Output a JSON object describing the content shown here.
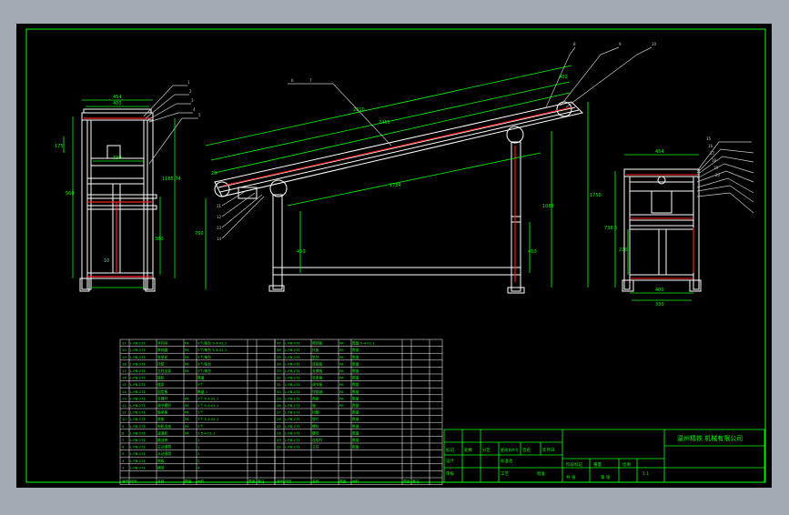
{
  "drawing": {
    "background_color": "#000000",
    "frame_color": "#00ff00",
    "line_color": "#ffffff",
    "accent_color": "#ff2020",
    "leader_color": "#c8c8c8",
    "company": "温州精铁 机械有限公司"
  },
  "dimensions": {
    "front_top": "454",
    "front_inner": "400",
    "front_mid": "330",
    "front_left_175": "175",
    "front_left_560": "560",
    "front_1165": "1165.74",
    "front_380": "380",
    "front_10": "10",
    "side_2610": "2610",
    "side_2455": "2455",
    "side_1784": "1784",
    "side_1750": "1750",
    "side_1088": "1088",
    "side_400": "400",
    "side_450": "450",
    "side_760": "760",
    "side_20": "20",
    "right_top": "454",
    "right_left": "738.5",
    "right_220": "220",
    "right_bottom": "400",
    "right_base": "330"
  },
  "bom": {
    "rows_left": [
      [
        "21",
        "L-PB-271",
        "导向块",
        "PA",
        "3个/每台 5-4-01.1"
      ],
      [
        "20",
        "L-PB-271",
        "联轴器",
        "PA",
        "3个/每台 5-4-01.1"
      ],
      [
        "19",
        "L-PB-271",
        "张紧轮",
        "PA",
        "3个/每台"
      ],
      [
        "18",
        "L-PB-271",
        "托辊",
        "PA",
        "3个/每台"
      ],
      [
        "17",
        "L-PB-271",
        "立柱支架",
        "PA",
        "3个/每台"
      ],
      [
        "16",
        "L-PB-271",
        "链轮",
        "",
        "数量"
      ],
      [
        "15",
        "L-PB-271",
        "链条",
        "",
        "3个"
      ],
      [
        "14",
        "L-PB-271",
        "固定板",
        "",
        "数量 1"
      ],
      [
        "13",
        "L-PB-271",
        "支撑杆",
        "PA",
        "3个 5-4-01.1"
      ],
      [
        "12",
        "L-PB-271",
        "调节螺杆",
        "PA",
        "3个 5-4-01.1"
      ],
      [
        "11",
        "L-PB-271",
        "轴承座",
        "PA",
        "3个"
      ],
      [
        "10",
        "L-PB-271",
        "底座",
        "PA",
        "3个 5-4-01.1"
      ],
      [
        "9",
        "L-PB-271",
        "电机支座",
        "PA",
        "3个"
      ],
      [
        "8",
        "L-PB-271",
        "减速机",
        "PA",
        "1 5-4-01.1"
      ],
      [
        "7",
        "L-PB-271",
        "输送带",
        "",
        "1"
      ],
      [
        "6",
        "L-PB-271",
        "主动滚筒",
        "",
        "1"
      ],
      [
        "5",
        "L-PB-271",
        "从动滚筒",
        "",
        "1"
      ],
      [
        "4",
        "L-PB-271",
        "侧板",
        "",
        "2"
      ],
      [
        "3",
        "L-PB-271",
        "横梁",
        "",
        "4"
      ]
    ],
    "rows_right": [
      [
        "37",
        "L-PB-271",
        "侧挡板",
        "PA",
        "数量 5-4-01.1"
      ],
      [
        "36",
        "L-PB-271",
        "托板",
        "PA",
        "数量"
      ],
      [
        "35",
        "L-PB-271",
        "垫块",
        "PA",
        "数量"
      ],
      [
        "34",
        "L-PB-271",
        "连接板",
        "PA",
        "数量"
      ],
      [
        "33",
        "L-PB-271",
        "支撑板",
        "PA",
        "数量"
      ],
      [
        "32",
        "L-PB-271",
        "张紧座",
        "PA",
        "数量"
      ],
      [
        "31",
        "L-PB-271",
        "调节板",
        "PA",
        "数量"
      ],
      [
        "30",
        "L-PB-271",
        "铰链轴",
        "PA",
        "数量"
      ],
      [
        "29",
        "L-PB-271",
        "角座",
        "PA",
        "数量"
      ],
      [
        "28",
        "L-PB-271",
        "轴",
        "PA",
        "数量"
      ],
      [
        "27",
        "L-PB-271",
        "挡圈",
        "",
        "数量"
      ],
      [
        "26",
        "L-PB-271",
        "垫片",
        "",
        "数量"
      ],
      [
        "25",
        "L-PB-271",
        "螺栓",
        "",
        "数量"
      ],
      [
        "24",
        "L-PB-271",
        "螺母",
        "",
        "数量"
      ],
      [
        "23",
        "L-PB-271",
        "连接杆",
        "",
        "数量"
      ],
      [
        "22",
        "L-PB-271",
        "立柱",
        "",
        "数量"
      ],
      [
        "",
        "",
        "",
        "",
        ""
      ],
      [
        "",
        "",
        "",
        "",
        ""
      ],
      [
        "",
        "",
        "",
        "",
        ""
      ]
    ],
    "header": [
      "序号",
      "代号",
      "名称",
      "数量",
      "材料",
      "重量",
      "备注"
    ]
  },
  "title_block": {
    "labels": [
      "标记",
      "处数",
      "分区",
      "更改文件号",
      "签名",
      "年月日",
      "设计",
      "标准化",
      "阶段标记",
      "重量",
      "比例",
      "审核",
      "工艺",
      "批准",
      "共 张",
      "第 张"
    ],
    "scale": "1:1"
  },
  "callouts": [
    "1",
    "2",
    "3",
    "4",
    "5",
    "6",
    "7",
    "8",
    "9",
    "10",
    "11",
    "12",
    "13",
    "14",
    "15",
    "16",
    "17",
    "18",
    "19",
    "20"
  ]
}
